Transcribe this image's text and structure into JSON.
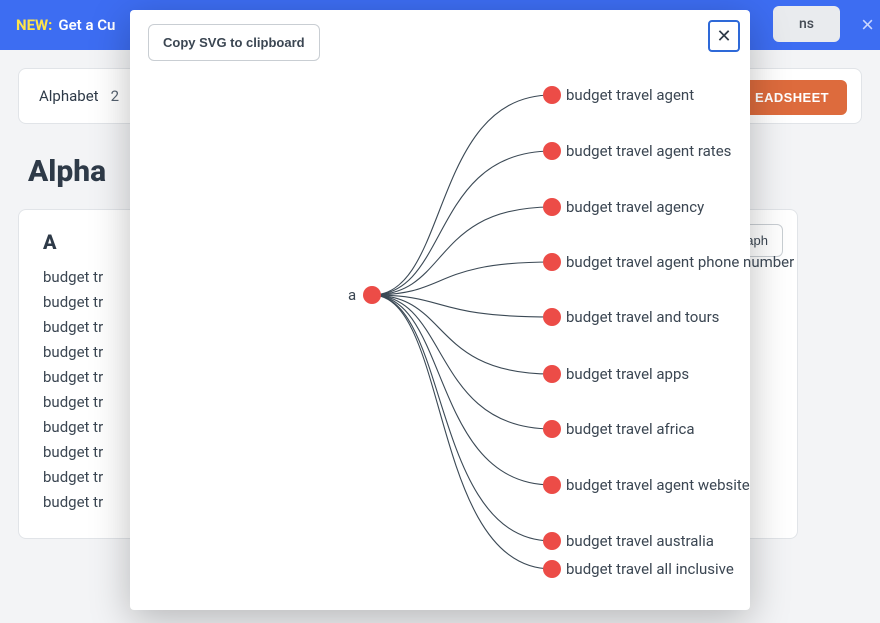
{
  "banner": {
    "new_label": "NEW:",
    "text": "Get a Cu",
    "pill_text": "ns"
  },
  "tabbar": {
    "label": "Alphabet",
    "count": "2",
    "download_label": "EADSHEET"
  },
  "page_title": "Alpha",
  "card_a": {
    "letter": "A",
    "items": [
      "budget tr",
      "budget tr",
      "budget tr",
      "budget tr",
      "budget tr",
      "budget tr",
      "budget tr",
      "budget tr",
      "budget tr",
      "budget tr"
    ]
  },
  "card_b": {
    "show_graph_label": "ow graph"
  },
  "modal": {
    "copy_label": "Copy SVG to clipboard",
    "close_label": "✕",
    "root_label": "a",
    "leaves": [
      "budget travel agent",
      "budget travel agent rates",
      "budget travel agency",
      "budget travel agent phone number",
      "budget travel and tours",
      "budget travel apps",
      "budget travel africa",
      "budget travel agent website",
      "budget travel australia",
      "budget travel all inclusive"
    ]
  },
  "colors": {
    "node": "#ec4c47",
    "edge": "#3b4955",
    "accent": "#3d6df2",
    "download": "#dd6b3d"
  }
}
